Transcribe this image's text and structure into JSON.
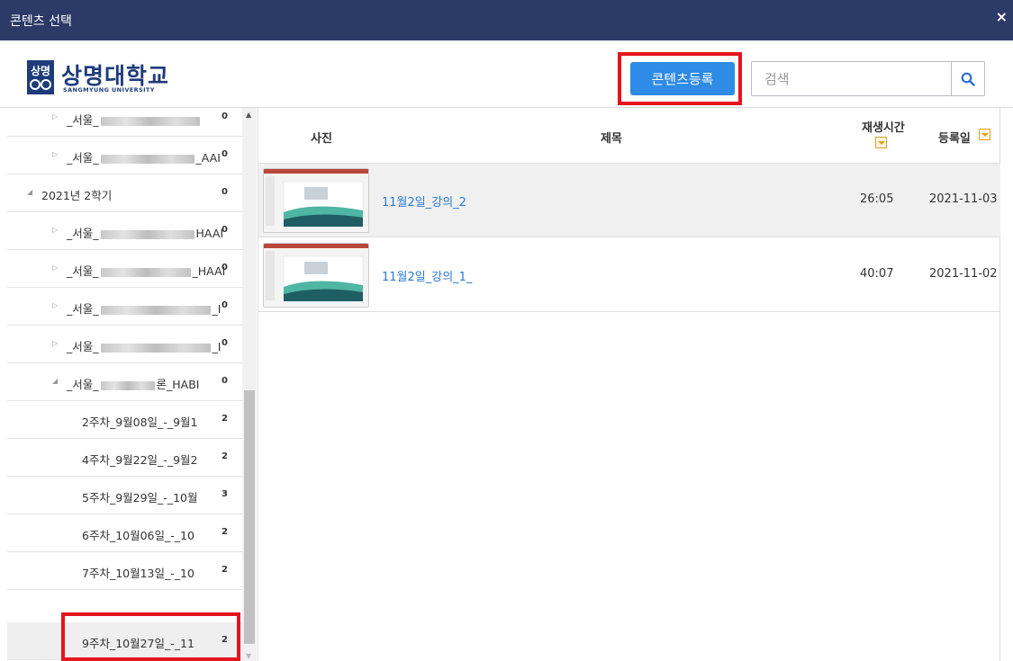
{
  "window": {
    "title": "콘텐츠 선택",
    "close": "×"
  },
  "logo": {
    "name": "상명대학교",
    "sub": "SANGMYUNG UNIVERSITY",
    "mark_text": "상명"
  },
  "toolbar": {
    "register_label": "콘텐츠등록",
    "search_placeholder": "검색"
  },
  "tree": {
    "rows": [
      {
        "prefix": "_서울_",
        "suffix": "",
        "count": "0",
        "expanded": false
      },
      {
        "prefix": "_서울_",
        "suffix": "_AAI",
        "count": "0",
        "expanded": false
      },
      {
        "prefix": "2021년 2학기",
        "suffix": "",
        "count": "0",
        "expanded": true
      },
      {
        "prefix": "_서울_",
        "suffix": "HAAI",
        "count": "0",
        "expanded": false
      },
      {
        "prefix": "_서울_",
        "suffix": "_HAAI",
        "count": "0",
        "expanded": false
      },
      {
        "prefix": "_서울_",
        "suffix": "_I",
        "count": "0",
        "expanded": false
      },
      {
        "prefix": "_서울_",
        "suffix": "_I",
        "count": "0",
        "expanded": false
      },
      {
        "prefix": "_서울_",
        "suffix": "론_HABI",
        "count": "0",
        "expanded": true
      },
      {
        "prefix": "2주차_9월08일_-_9월1",
        "suffix": "",
        "count": "2",
        "expanded": false
      },
      {
        "prefix": "4주차_9월22일_-_9월2",
        "suffix": "",
        "count": "2",
        "expanded": false
      },
      {
        "prefix": "5주차_9월29일_-_10월",
        "suffix": "",
        "count": "3",
        "expanded": false
      },
      {
        "prefix": "6주차_10월06일_-_10",
        "suffix": "",
        "count": "2",
        "expanded": false
      },
      {
        "prefix": "7주차_10월13일_-_10",
        "suffix": "",
        "count": "2",
        "expanded": false
      },
      {
        "prefix": "9주차_10월27일_-_11",
        "suffix": "",
        "count": "2",
        "expanded": false
      }
    ]
  },
  "table": {
    "headers": {
      "photo": "사진",
      "title": "제목",
      "duration": "재생시간",
      "date": "등록일"
    },
    "rows": [
      {
        "title": "11월2일_강의_2",
        "duration": "26:05",
        "date": "2021-11-03"
      },
      {
        "title": "11월2일_강의_1_",
        "duration": "40:07",
        "date": "2021-11-02"
      }
    ]
  },
  "colors": {
    "titlebar": "#2b3a67",
    "accent": "#2e8be6",
    "highlight": "#e5141e",
    "link": "#2b7bd0"
  }
}
